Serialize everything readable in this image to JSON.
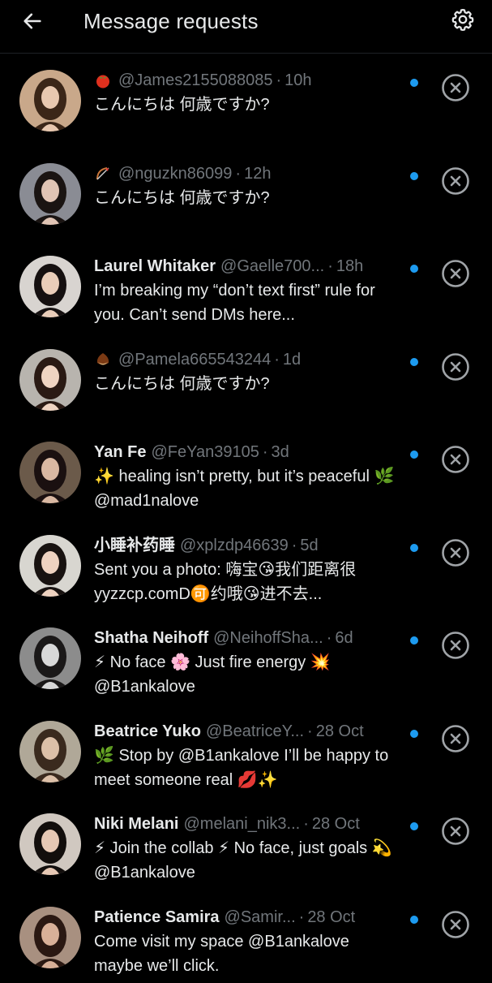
{
  "header": {
    "title": "Message requests",
    "back_icon": "arrow-left-icon",
    "settings_icon": "gear-icon"
  },
  "colors": {
    "background": "#000000",
    "primary_text": "#e7e9ea",
    "secondary_text": "#71767b",
    "unread_dot": "#1d9bf0",
    "divider": "#1f2226"
  },
  "requests": [
    {
      "name": "",
      "badge": "tomato-emoji",
      "handle": "@James2155088085",
      "sep": "·",
      "time": "10h",
      "preview": "こんにちは 何歳ですか?",
      "unread": true
    },
    {
      "name": "",
      "badge": "bow-arrow-emoji",
      "handle": "@nguzkn86099",
      "sep": "·",
      "time": "12h",
      "preview": "こんにちは 何歳ですか?",
      "unread": true
    },
    {
      "name": "Laurel Whitaker",
      "badge": "",
      "handle": "@Gaelle700...",
      "sep": "·",
      "time": "18h",
      "preview": "I’m breaking my “don’t text first” rule for you. Can’t send DMs here...",
      "unread": true
    },
    {
      "name": "",
      "badge": "chestnut-emoji",
      "handle": "@Pamela665543244",
      "sep": "·",
      "time": "1d",
      "preview": "こんにちは 何歳ですか?",
      "unread": true
    },
    {
      "name": "Yan Fe",
      "badge": "",
      "handle": "@FeYan39105",
      "sep": "·",
      "time": "3d",
      "preview": "✨ healing isn’t pretty, but it’s peaceful 🌿 @mad1nalove",
      "unread": true
    },
    {
      "name": "小睡补药睡",
      "badge": "",
      "handle": "@xplzdp46639",
      "sep": "·",
      "time": "5d",
      "preview": "Sent you a photo: 嗨宝😘我们距离很yyzzcp.comD🉑约哦😘进不去...",
      "unread": true
    },
    {
      "name": "Shatha Neihoff",
      "badge": "",
      "handle": "@NeihoffSha...",
      "sep": "·",
      "time": "6d",
      "preview": "⚡ No face 🌸 Just fire energy 💥 @B1ankalove",
      "unread": true
    },
    {
      "name": "Beatrice Yuko",
      "badge": "",
      "handle": "@BeatriceY...",
      "sep": "·",
      "time": "28 Oct",
      "preview": "🌿 Stop by @B1ankalove I’ll be happy to meet someone real 💋✨",
      "unread": true
    },
    {
      "name": "Niki Melani",
      "badge": "",
      "handle": "@melani_nik3...",
      "sep": "·",
      "time": "28 Oct",
      "preview": "⚡ Join the collab ⚡ No face, just goals 💫@B1ankalove",
      "unread": true
    },
    {
      "name": "Patience Samira",
      "badge": "",
      "handle": "@Samir...",
      "sep": "·",
      "time": "28 Oct",
      "preview": "Come visit my space @B1ankalove maybe we’ll click.",
      "unread": true
    }
  ]
}
